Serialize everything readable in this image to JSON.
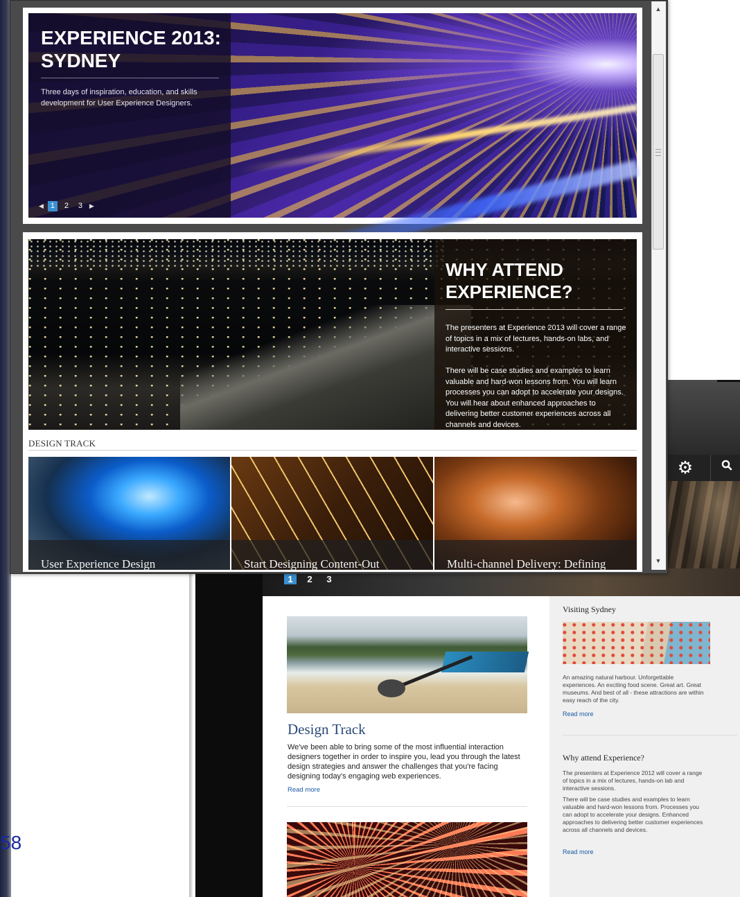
{
  "background_page": {
    "slide_number": "58",
    "pager": [
      "1",
      "2",
      "3"
    ],
    "pager_active": "1",
    "design_track": {
      "title": "Design Track",
      "body": "We've been able to bring some of the most influential interaction designers together in order to inspire you, lead you through the latest design strategies and answer the challenges that you're facing designing today's engaging web experiences.",
      "read_more": "Read more"
    },
    "sidebar": {
      "visiting_title": "Visiting Sydney",
      "visiting_body": "An amazing natural harbour. Unforgettable experiences. An exciting food scene. Great art. Great museums. And best of all - these attractions are within easy reach of the city.",
      "visiting_read_more": "Read more",
      "why_title": "Why attend Experience?",
      "why_body1": "The presenters at Experience 2012 will cover a range of topics in a mix of lectures, hands-on lab and interactive sessions.",
      "why_body2": "There will be case studies and examples to learn valuable and hard-won lessons from. Processes you can adopt to accelerate your designs. Enhanced approaches to delivering better customer experiences across all channels and devices.",
      "why_read_more": "Read more"
    },
    "icons": [
      "gear-icon",
      "search-icon"
    ]
  },
  "window": {
    "hero": {
      "title": "EXPERIENCE 2013: SYDNEY",
      "subtitle": "Three days of inspiration, education, and skills development for User Experience Designers.",
      "pager": [
        "1",
        "2",
        "3"
      ],
      "pager_active": "1"
    },
    "why": {
      "title": "WHY ATTEND EXPERIENCE?",
      "p1": "The presenters at Experience 2013 will cover a range of topics in a mix of lectures, hands-on labs, and interactive sessions.",
      "p2": "There will be case studies and examples to learn valuable and hard-won lessons from. You will learn processes you can adopt to accelerate your designs. You will hear about enhanced approaches to delivering better customer experiences across all channels and devices."
    },
    "track_label": "DESIGN TRACK",
    "cards": [
      {
        "title": "User Experience Design"
      },
      {
        "title": "Start Designing Content-Out"
      },
      {
        "title": "Multi-channel Delivery: Defining"
      }
    ],
    "scrollbar": {
      "up": "▲",
      "down": "▼"
    }
  },
  "colors": {
    "accent_blue": "#3a8fd0",
    "link_blue": "#1a5aa6",
    "heading_blue": "#2a4a7a"
  }
}
